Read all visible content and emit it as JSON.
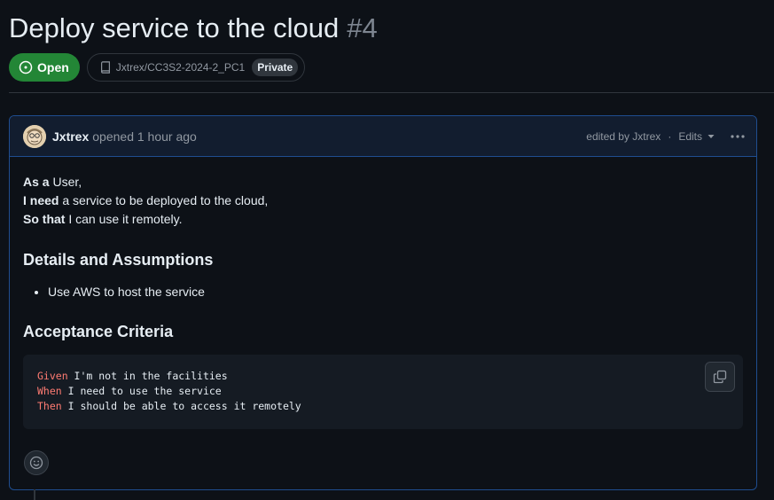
{
  "issue": {
    "title": "Deploy service to the cloud",
    "number": "#4",
    "state": "Open",
    "repo": "Jxtrex/CC3S2-2024-2_PC1",
    "visibility": "Private"
  },
  "comment": {
    "author": "Jxtrex",
    "opened_text": "opened 1 hour ago",
    "edited_text": "edited by Jxtrex",
    "separator": "·",
    "edits_label": "Edits",
    "story": [
      {
        "bold": "As a",
        "text": " User,"
      },
      {
        "bold": "I need",
        "text": " a service to be deployed to the cloud,"
      },
      {
        "bold": "So that",
        "text": " I can use it remotely."
      }
    ],
    "details_heading": "Details and Assumptions",
    "details_items": [
      "Use AWS to host the service"
    ],
    "criteria_heading": "Acceptance Criteria",
    "code_lines": [
      {
        "keyword": "Given",
        "text": " I'm not in the facilities"
      },
      {
        "keyword": "When",
        "text": " I need to use the service"
      },
      {
        "keyword": "Then",
        "text": " I should be able to access it remotely"
      }
    ]
  },
  "icons": {
    "state": "issue-opened-icon",
    "repo": "repo-icon",
    "caret": "triangle-down-icon",
    "kebab": "kebab-horizontal-icon",
    "copy": "copy-icon",
    "reaction": "smiley-icon"
  },
  "colors": {
    "open_green": "#238636",
    "keyword_red": "#ff7b72",
    "comment_border": "#1f4d8f"
  }
}
